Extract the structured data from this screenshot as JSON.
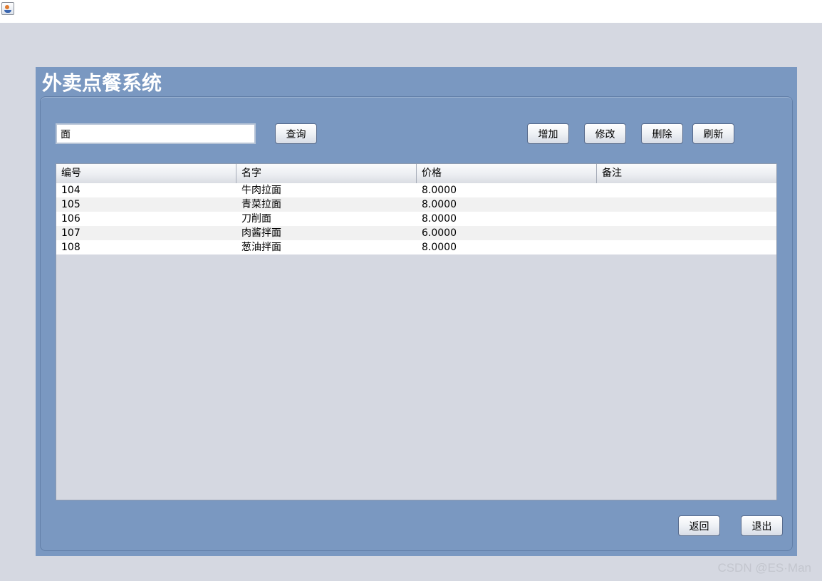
{
  "app": {
    "title": "外卖点餐系统"
  },
  "search": {
    "value": "面",
    "query_button": "查询"
  },
  "toolbar": {
    "add_label": "增加",
    "edit_label": "修改",
    "delete_label": "删除",
    "refresh_label": "刷新"
  },
  "table": {
    "columns": [
      "编号",
      "名字",
      "价格",
      "备注"
    ],
    "rows": [
      [
        "104",
        "牛肉拉面",
        "8.0000",
        ""
      ],
      [
        "105",
        "青菜拉面",
        "8.0000",
        ""
      ],
      [
        "106",
        "刀削面",
        "8.0000",
        ""
      ],
      [
        "107",
        "肉酱拌面",
        "6.0000",
        ""
      ],
      [
        "108",
        "葱油拌面",
        "8.0000",
        ""
      ]
    ]
  },
  "footer": {
    "back_label": "返回",
    "exit_label": "退出"
  },
  "watermark": "CSDN @ES·Man",
  "colors": {
    "background": "#d5d8e1",
    "panel": "#7a98c1",
    "title_text": "#ffffff"
  }
}
